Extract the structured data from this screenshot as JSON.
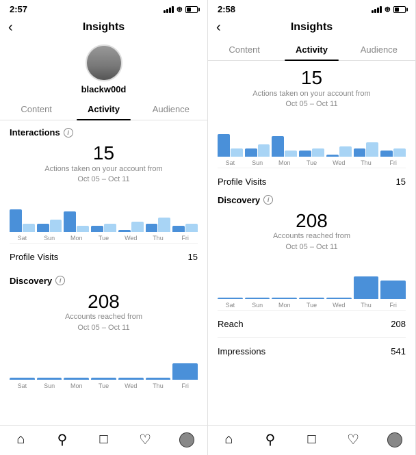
{
  "left": {
    "status": {
      "time": "2:57",
      "arrow": "↑"
    },
    "header": {
      "title": "Insights",
      "back_icon": "‹"
    },
    "username": "blackw00d",
    "tabs": [
      {
        "label": "Content",
        "active": false
      },
      {
        "label": "Activity",
        "active": true
      },
      {
        "label": "Audience",
        "active": false
      }
    ],
    "interactions": {
      "heading": "Interactions",
      "stat_number": "15",
      "stat_desc": "Actions taken on your account from\nOct 05 – Oct 11",
      "chart": {
        "days": [
          "Sat",
          "Sun",
          "Mon",
          "Tue",
          "Wed",
          "Thu",
          "Fri"
        ],
        "dark_heights": [
          55,
          20,
          50,
          15,
          5,
          20,
          15
        ],
        "light_heights": [
          20,
          30,
          15,
          20,
          25,
          35,
          20
        ]
      },
      "profile_visits_label": "Profile Visits",
      "profile_visits_value": "15"
    },
    "discovery": {
      "heading": "Discovery",
      "stat_number": "208",
      "stat_desc": "Accounts reached from\nOct 05 – Oct 11",
      "chart": {
        "days": [
          "Sat",
          "Sun",
          "Mon",
          "Tue",
          "Wed",
          "Thu",
          "Fri"
        ],
        "dark_heights": [
          5,
          5,
          5,
          5,
          5,
          5,
          40
        ],
        "light_heights": [
          0,
          0,
          0,
          0,
          0,
          0,
          0
        ]
      }
    }
  },
  "right": {
    "status": {
      "time": "2:58",
      "arrow": "↑"
    },
    "header": {
      "title": "Insights",
      "back_icon": "‹"
    },
    "tabs": [
      {
        "label": "Content",
        "active": false
      },
      {
        "label": "Activity",
        "active": true
      },
      {
        "label": "Audience",
        "active": false
      }
    ],
    "interactions": {
      "stat_number": "15",
      "stat_desc": "Actions taken on your account from\nOct 05 – Oct 11",
      "chart": {
        "days": [
          "Sat",
          "Sun",
          "Mon",
          "Tue",
          "Wed",
          "Thu",
          "Fri"
        ],
        "dark_heights": [
          55,
          20,
          50,
          15,
          5,
          20,
          15
        ],
        "light_heights": [
          20,
          30,
          15,
          20,
          25,
          35,
          20
        ]
      },
      "profile_visits_label": "Profile Visits",
      "profile_visits_value": "15"
    },
    "discovery": {
      "heading": "Discovery",
      "stat_number": "208",
      "stat_desc": "Accounts reached from\nOct 05 – Oct 11",
      "chart": {
        "days": [
          "Sat",
          "Sun",
          "Mon",
          "Tue",
          "Wed",
          "Thu",
          "Fri"
        ],
        "dark_heights": [
          4,
          4,
          4,
          4,
          4,
          55,
          45
        ],
        "light_heights": [
          0,
          0,
          0,
          0,
          0,
          0,
          0
        ]
      },
      "reach_label": "Reach",
      "reach_value": "208",
      "impressions_label": "Impressions",
      "impressions_value": "541"
    },
    "nav": [
      "🏠",
      "🔍",
      "⊕",
      "♡",
      "👤"
    ]
  },
  "nav": {
    "home": "🏠",
    "search": "🔍",
    "add": "⊕",
    "heart": "♡",
    "profile": "👤"
  }
}
